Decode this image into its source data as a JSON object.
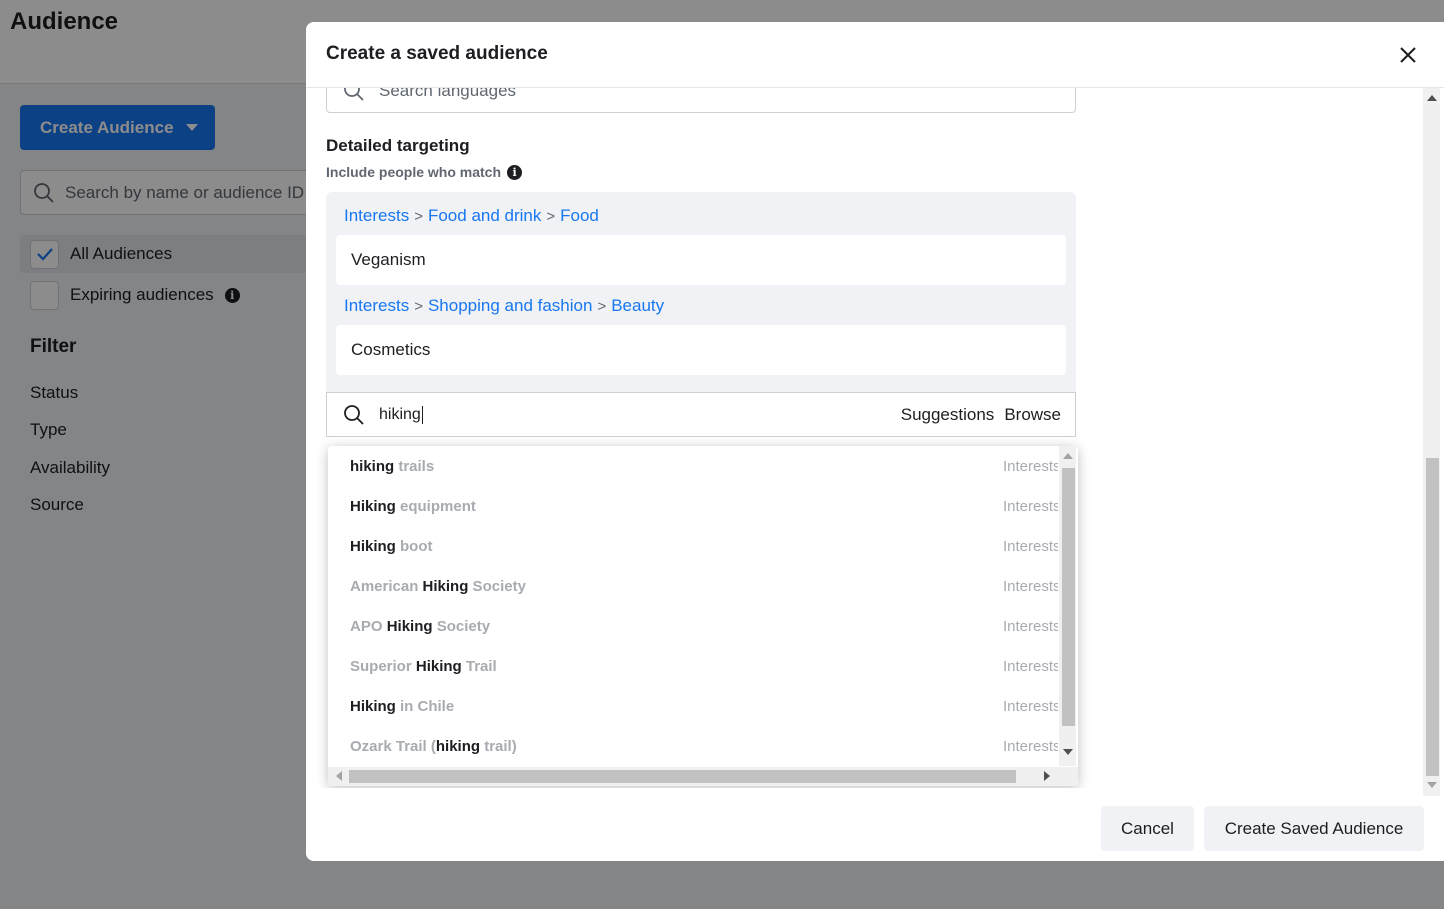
{
  "page": {
    "title": "Audience",
    "create_audience_label": "Create Audience",
    "search_placeholder": "Search by name or audience ID",
    "all_audiences_label": "All Audiences",
    "expiring_label": "Expiring audiences",
    "filter_heading": "Filter",
    "filters": [
      "Status",
      "Type",
      "Availability",
      "Source"
    ]
  },
  "dialog": {
    "title": "Create a saved audience",
    "languages_placeholder": "Search languages",
    "detailed_targeting_title": "Detailed targeting",
    "include_label": "Include people who match",
    "groups": [
      {
        "path": [
          "Interests",
          "Food and drink",
          "Food"
        ],
        "item": "Veganism"
      },
      {
        "path": [
          "Interests",
          "Shopping and fashion",
          "Beauty"
        ],
        "item": "Cosmetics"
      }
    ],
    "search_value": "hiking",
    "suggestions_label": "Suggestions",
    "browse_label": "Browse",
    "results": [
      {
        "pre": "",
        "match": "hiking",
        "post": " trails",
        "type": "Interests"
      },
      {
        "pre": "",
        "match": "Hiking",
        "post": " equipment",
        "type": "Interests"
      },
      {
        "pre": "",
        "match": "Hiking",
        "post": " boot",
        "type": "Interests"
      },
      {
        "pre": "American ",
        "match": "Hiking",
        "post": " Society",
        "type": "Interests"
      },
      {
        "pre": "APO ",
        "match": "Hiking",
        "post": " Society",
        "type": "Interests"
      },
      {
        "pre": "Superior ",
        "match": "Hiking",
        "post": " Trail",
        "type": "Interests"
      },
      {
        "pre": "",
        "match": "Hiking",
        "post": " in Chile",
        "type": "Interests"
      },
      {
        "pre": "Ozark Trail (",
        "match": "hiking",
        "post": " trail)",
        "type": "Interests"
      }
    ],
    "cancel_label": "Cancel",
    "create_label": "Create Saved Audience"
  },
  "colors": {
    "accent": "#1877f2",
    "link": "#1877f2",
    "muted": "#a8abb0",
    "text": "#1c1e21"
  }
}
